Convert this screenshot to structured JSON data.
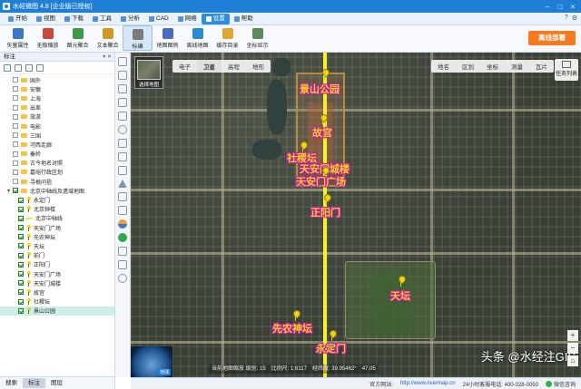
{
  "titlebar": {
    "title": "水经微图 4.8 [企业版已授权]"
  },
  "menu": [
    {
      "label": "开始",
      "active": false
    },
    {
      "label": "视图",
      "active": false
    },
    {
      "label": "下载",
      "active": false
    },
    {
      "label": "工具",
      "active": false
    },
    {
      "label": "分析",
      "active": false
    },
    {
      "label": "CAD",
      "active": false
    },
    {
      "label": "网络",
      "active": false
    },
    {
      "label": "设置",
      "active": true
    },
    {
      "label": "帮助",
      "active": false
    }
  ],
  "toolbar": {
    "tools": [
      {
        "label": "矢量属性",
        "icon": "vector-properties-icon",
        "color": "#3b78c4"
      },
      {
        "label": "无极缩放",
        "icon": "infinite-zoom-icon",
        "color": "#c84a3a"
      },
      {
        "label": "图元聚合",
        "icon": "feature-cluster-icon",
        "color": "#3b9a4a"
      },
      {
        "label": "文本聚合",
        "icon": "text-cluster-icon",
        "color": "#d09a20"
      },
      {
        "label": "标编",
        "icon": "label-edit-icon",
        "color": "#7a7a7a"
      },
      {
        "label": "地图图例",
        "icon": "map-legend-icon",
        "color": "#4a6ac8"
      },
      {
        "label": "离线地图",
        "icon": "offline-map-icon",
        "color": "#2a8ad0"
      },
      {
        "label": "缓存目录",
        "icon": "cache-folder-icon",
        "color": "#e0a830"
      },
      {
        "label": "坐标显示",
        "icon": "coordinate-display-icon",
        "color": "#5a8a5a"
      }
    ],
    "offline_deploy": "离线部署"
  },
  "leftpanel": {
    "header": "标注",
    "tree": [
      {
        "label": "国外",
        "type": "folder",
        "checked": false,
        "indent": 0
      },
      {
        "label": "安徽",
        "type": "folder",
        "checked": false,
        "indent": 0
      },
      {
        "label": "上海",
        "type": "folder",
        "checked": false,
        "indent": 0
      },
      {
        "label": "出差",
        "type": "folder",
        "checked": false,
        "indent": 0
      },
      {
        "label": "旅游",
        "type": "folder",
        "checked": false,
        "indent": 0
      },
      {
        "label": "电影",
        "type": "folder",
        "checked": false,
        "indent": 0
      },
      {
        "label": "三国",
        "type": "folder",
        "checked": false,
        "indent": 0
      },
      {
        "label": "河西走廊",
        "type": "folder",
        "checked": false,
        "indent": 0
      },
      {
        "label": "秦岭",
        "type": "folder",
        "checked": false,
        "indent": 0
      },
      {
        "label": "古今地名对照",
        "type": "folder",
        "checked": false,
        "indent": 0
      },
      {
        "label": "嘉峪行政区划",
        "type": "folder",
        "checked": false,
        "indent": 0
      },
      {
        "label": "寻根问祖",
        "type": "folder",
        "checked": false,
        "indent": 0
      },
      {
        "label": "北京中轴线及遗域地图",
        "type": "folder",
        "checked": true,
        "indent": 0,
        "expanded": true
      },
      {
        "label": "永定门",
        "type": "pin",
        "checked": true,
        "indent": 1
      },
      {
        "label": "北京钟楼",
        "type": "pin",
        "checked": true,
        "indent": 1
      },
      {
        "label": "北京中轴线",
        "type": "line",
        "checked": true,
        "indent": 1
      },
      {
        "label": "天安门广场",
        "type": "pin",
        "checked": true,
        "indent": 1
      },
      {
        "label": "先农神坛",
        "type": "pin",
        "checked": true,
        "indent": 1
      },
      {
        "label": "天坛",
        "type": "pin",
        "checked": true,
        "indent": 1
      },
      {
        "label": "前门",
        "type": "pin",
        "checked": true,
        "indent": 1
      },
      {
        "label": "正阳门",
        "type": "pin",
        "checked": true,
        "indent": 1
      },
      {
        "label": "天安门广场",
        "type": "pin",
        "checked": true,
        "indent": 1
      },
      {
        "label": "天安门城楼",
        "type": "pin",
        "checked": true,
        "indent": 1
      },
      {
        "label": "故宫",
        "type": "pin",
        "checked": true,
        "indent": 1
      },
      {
        "label": "社稷坛",
        "type": "pin",
        "checked": true,
        "indent": 1
      },
      {
        "label": "景山公园",
        "type": "pin",
        "checked": true,
        "indent": 1,
        "selected": true
      }
    ],
    "tabs": [
      {
        "label": "搜索",
        "active": false
      },
      {
        "label": "标注",
        "active": true
      },
      {
        "label": "图层",
        "active": false
      }
    ]
  },
  "map": {
    "select_map_label": "选择地图",
    "layer_buttons": [
      {
        "label": "电子",
        "active": false
      },
      {
        "label": "卫星",
        "active": true
      },
      {
        "label": "高程",
        "active": false
      },
      {
        "label": "地形",
        "active": false
      }
    ],
    "right_buttons": [
      "地名",
      "区划",
      "坐标",
      "测量",
      "瓦片"
    ],
    "task_list": "任务列表",
    "globe_label": "地球",
    "labels": [
      {
        "text": "景山公园",
        "pin": true
      },
      {
        "text": "故宫",
        "pin": true
      },
      {
        "text": "社稷坛",
        "pin": true
      },
      {
        "text": "天安门城楼",
        "pin": true
      },
      {
        "text": "天安门广场",
        "pin": true
      },
      {
        "text": "正阳门",
        "pin": true
      },
      {
        "text": "天坛",
        "pin": true
      },
      {
        "text": "先农神坛",
        "pin": true
      },
      {
        "text": "永定门",
        "pin": true
      }
    ],
    "status": {
      "zoom_text": "当前地图缩放 级别: 15",
      "scale_text": "比例尺: 1:6117",
      "coord_text": "经纬度: 39.95462°",
      "extra_text": "47.05"
    },
    "zoom_buttons": [
      "+",
      "−",
      "⌂"
    ],
    "watermark": "头条 @水经注GIS"
  },
  "statusbar": {
    "official_label": "官方网站:",
    "website": "http://www.rivermap.cn",
    "hotline": "24小时客服电话: 400-028-0050",
    "wechat": "微信咨询"
  }
}
